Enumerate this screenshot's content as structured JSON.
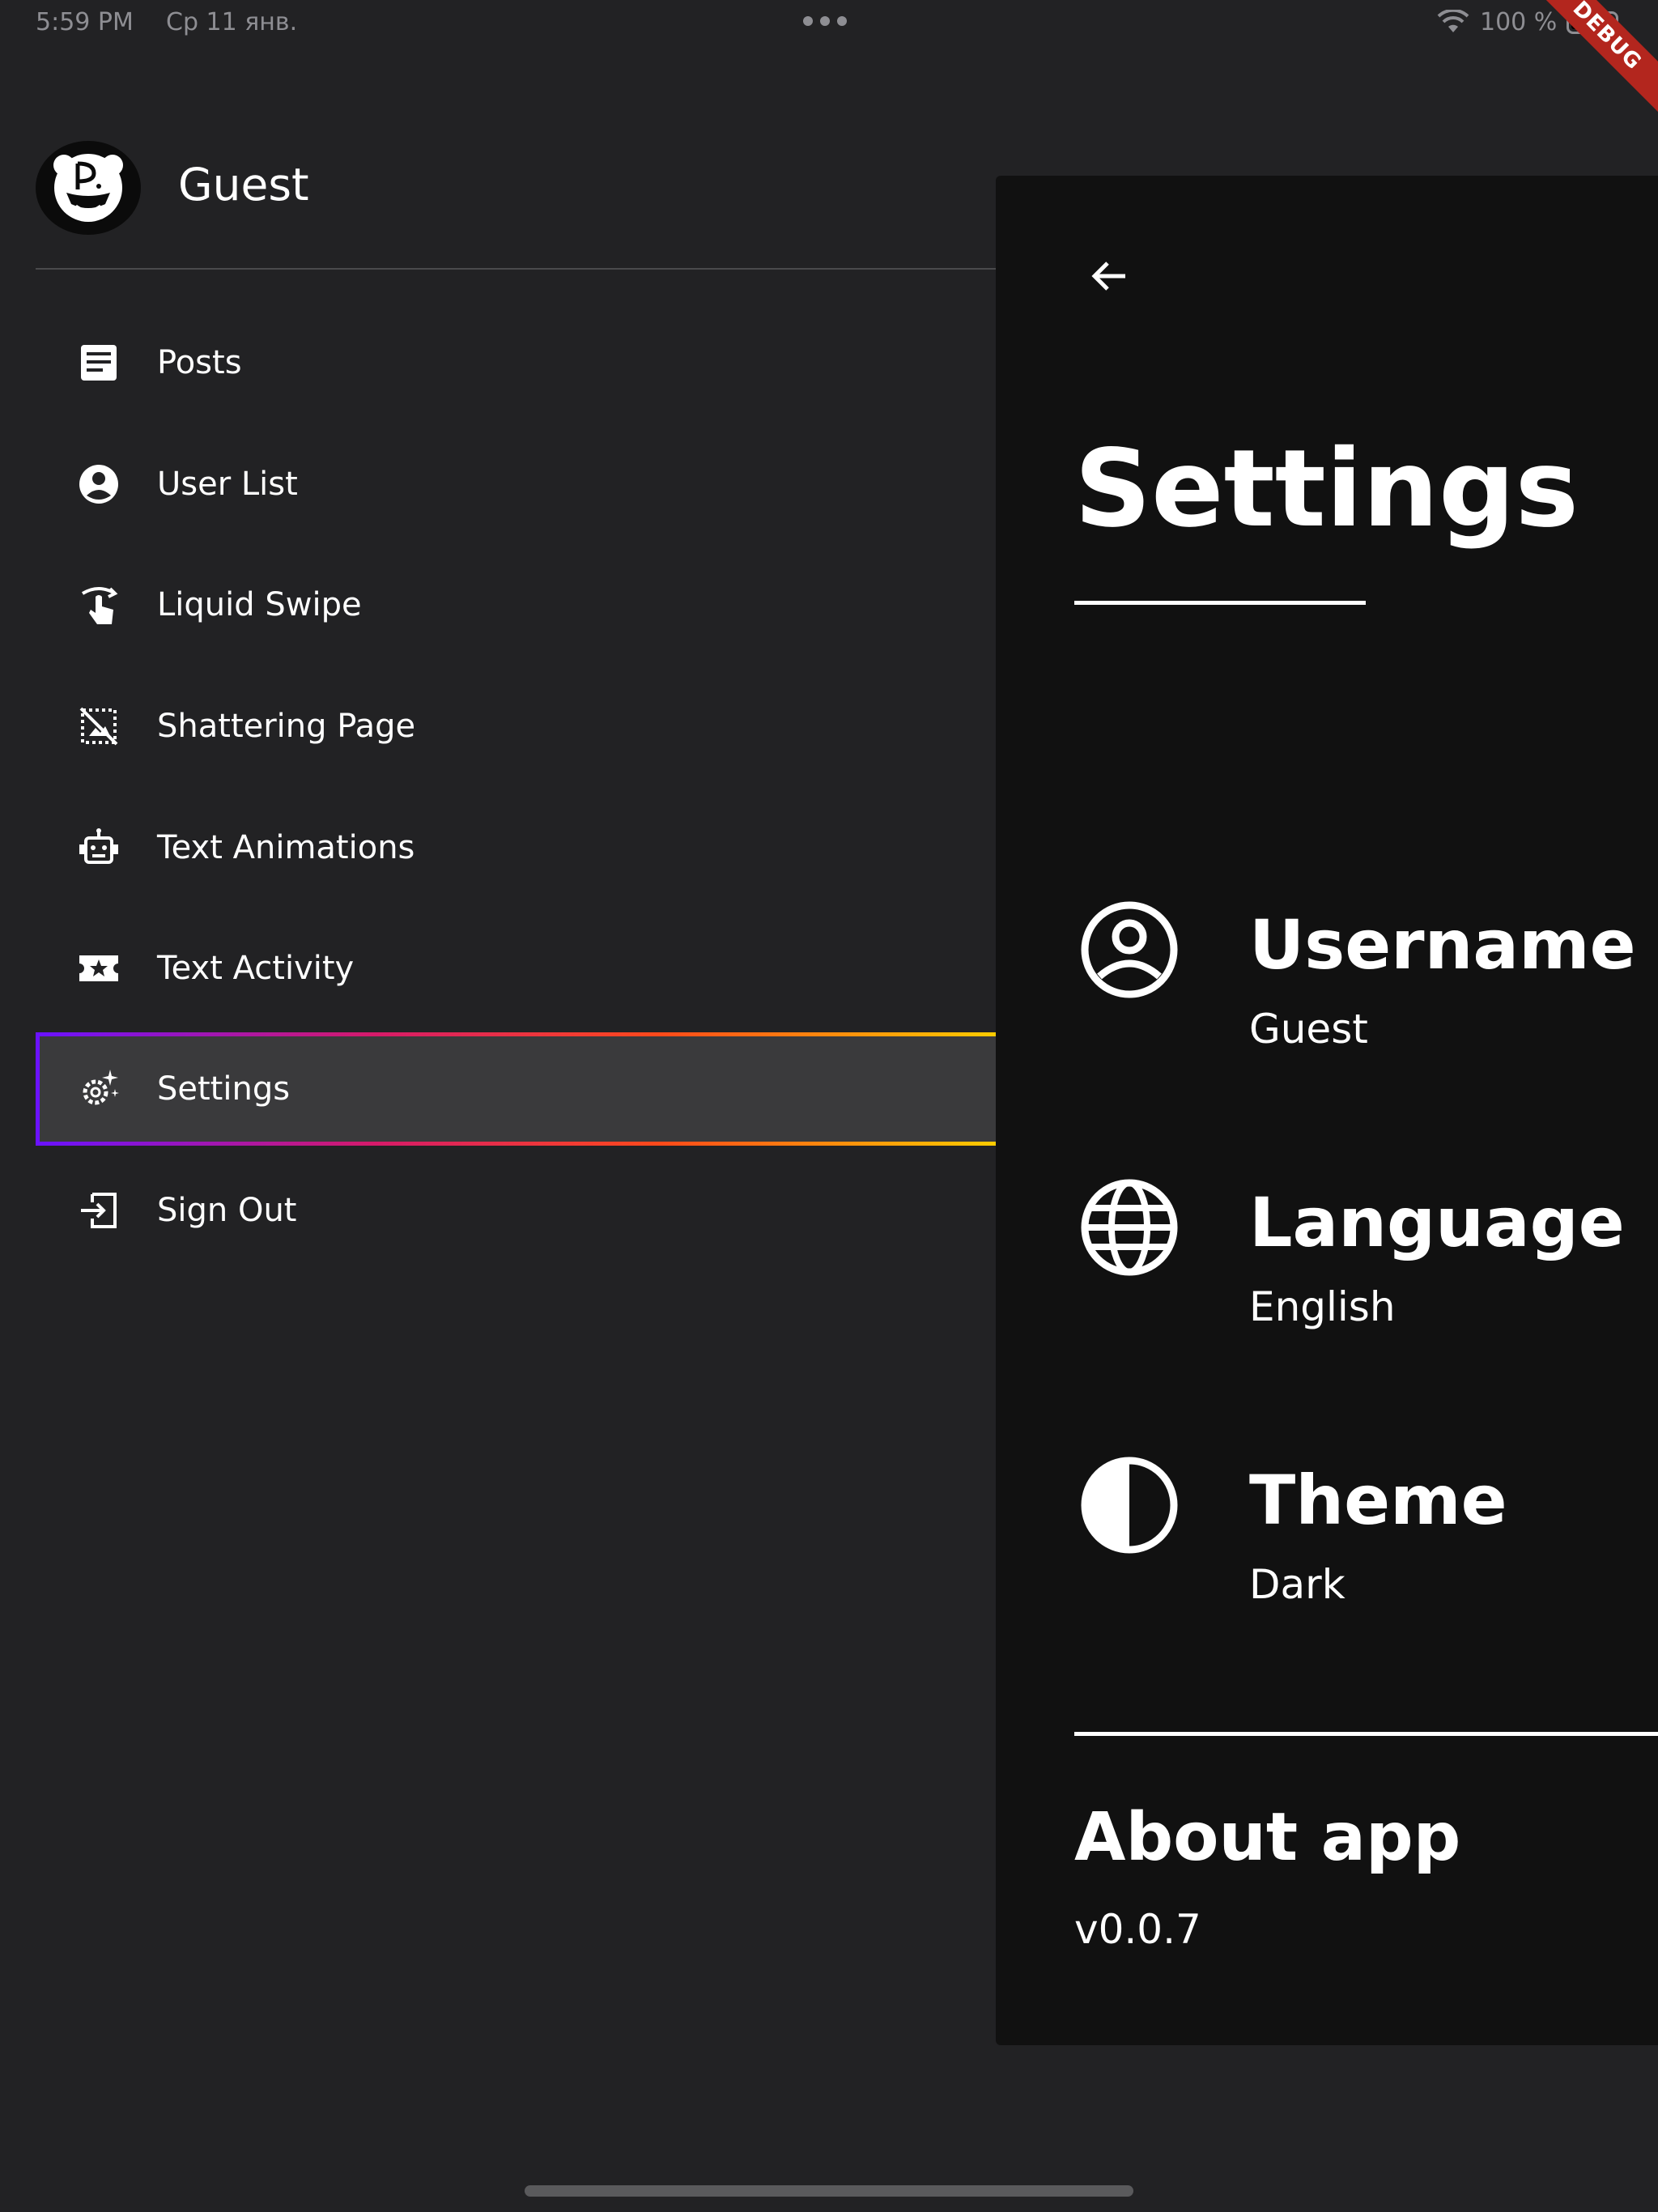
{
  "status_bar": {
    "time": "5:59 PM",
    "date": "Ср 11 янв.",
    "battery": "100 %",
    "debug_banner": "DEBUG"
  },
  "drawer": {
    "user_name": "Guest",
    "active_item": "Settings",
    "items": [
      {
        "label": "Posts",
        "icon": "article-icon"
      },
      {
        "label": "User List",
        "icon": "account-circle-icon"
      },
      {
        "label": "Liquid Swipe",
        "icon": "swipe-icon"
      },
      {
        "label": "Shattering Page",
        "icon": "hide-image-icon"
      },
      {
        "label": "Text Animations",
        "icon": "robot-icon"
      },
      {
        "label": "Text Activity",
        "icon": "local-activity-icon"
      },
      {
        "label": "Settings",
        "icon": "settings-suggest-icon"
      },
      {
        "label": "Sign Out",
        "icon": "exit-icon"
      }
    ],
    "active_gradient": [
      "#6a12ff",
      "#d61a6a",
      "#ff4a1a",
      "#ffcc00"
    ]
  },
  "settings": {
    "title": "Settings",
    "rows": [
      {
        "title": "Username",
        "value": "Guest",
        "icon": "account-circle-icon"
      },
      {
        "title": "Language",
        "value": "English",
        "icon": "globe-icon"
      },
      {
        "title": "Theme",
        "value": "Dark",
        "icon": "contrast-icon"
      }
    ],
    "about_title": "About app",
    "version": "v0.0.7"
  },
  "colors": {
    "background": "#222224",
    "panel": "#111111",
    "active_item_bg": "#3a3a3c"
  }
}
